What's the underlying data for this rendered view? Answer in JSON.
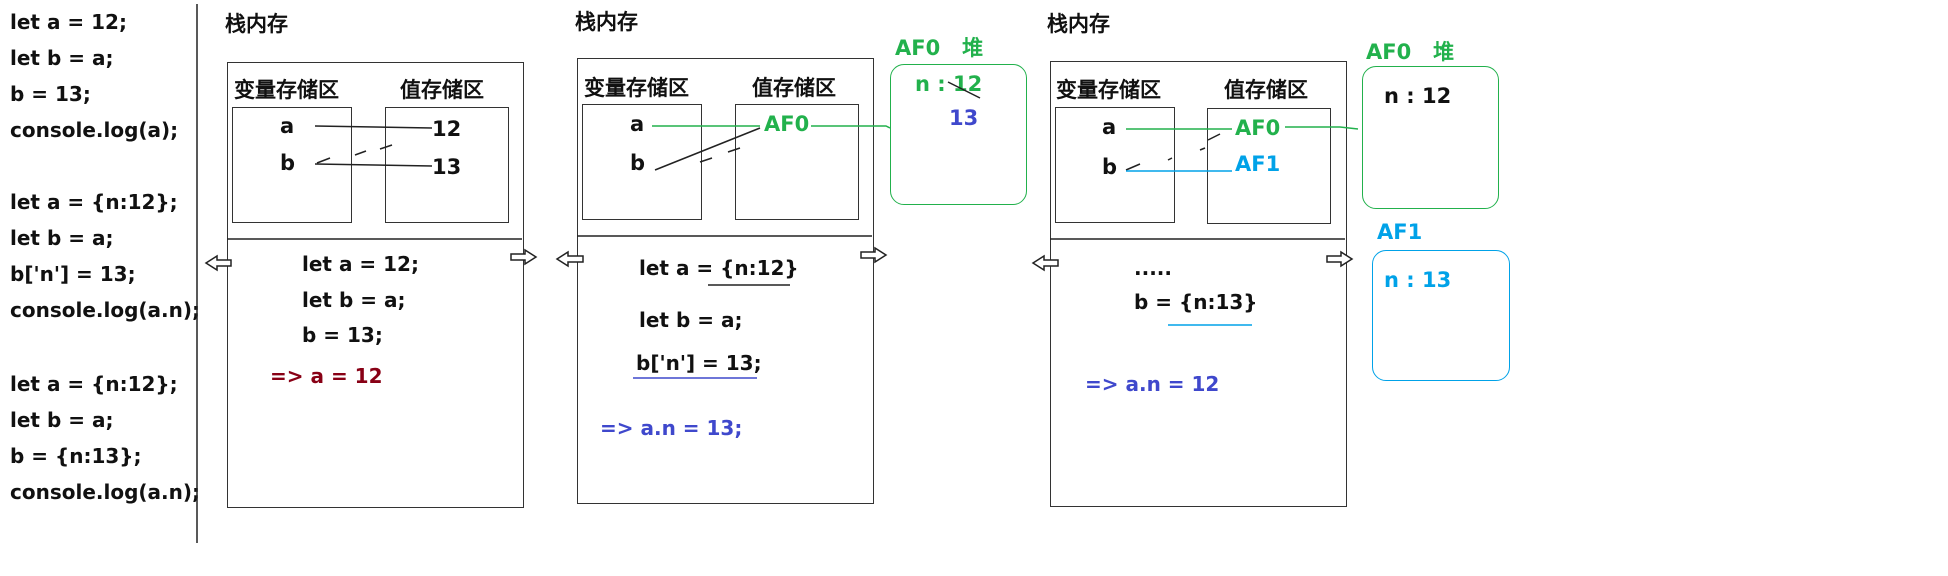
{
  "colors": {
    "green": "#22b14c",
    "blue": "#00a2e8",
    "indigo": "#3f48cc",
    "darkred": "#880015",
    "black": "#111111"
  },
  "left_code": {
    "lines": [
      "let a = 12;",
      "let b = a;",
      "b = 13;",
      "console.log(a);",
      "let a = {n:12};",
      "let b = a;",
      "b['n'] = 13;",
      "console.log(a.n);",
      "let a = {n:12};",
      "let b = a;",
      "b = {n:13};",
      "console.log(a.n);"
    ]
  },
  "panel1": {
    "title": "栈内存",
    "var_header": "变量存储区",
    "val_header": "值存储区",
    "var_a": "a",
    "var_b": "b",
    "val_a": "12",
    "val_b": "13",
    "code": [
      "let a = 12;",
      "let b = a;",
      "b = 13;"
    ],
    "result": "=> a = 12"
  },
  "panel2": {
    "title": "栈内存",
    "var_header": "变量存储区",
    "val_header": "值存储区",
    "var_a": "a",
    "var_b": "b",
    "val_addr": "AF0",
    "code": [
      "let a = {n:12}",
      "let b = a;",
      "b['n'] = 13;"
    ],
    "result": "=> a.n = 13;",
    "heap_title": "AF0   堆",
    "heap_n": "n : 12",
    "heap_new": "13"
  },
  "panel3": {
    "title": "栈内存",
    "var_header": "变量存储区",
    "val_header": "值存储区",
    "var_a": "a",
    "var_b": "b",
    "val_a": "AF0",
    "val_b": "AF1",
    "code": [
      ".....",
      "b = {n:13}"
    ],
    "result": "=> a.n = 12",
    "heap0_title": "AF0   堆",
    "heap0_n": "n : 12",
    "heap1_title": "AF1",
    "heap1_n": "n : 13"
  }
}
